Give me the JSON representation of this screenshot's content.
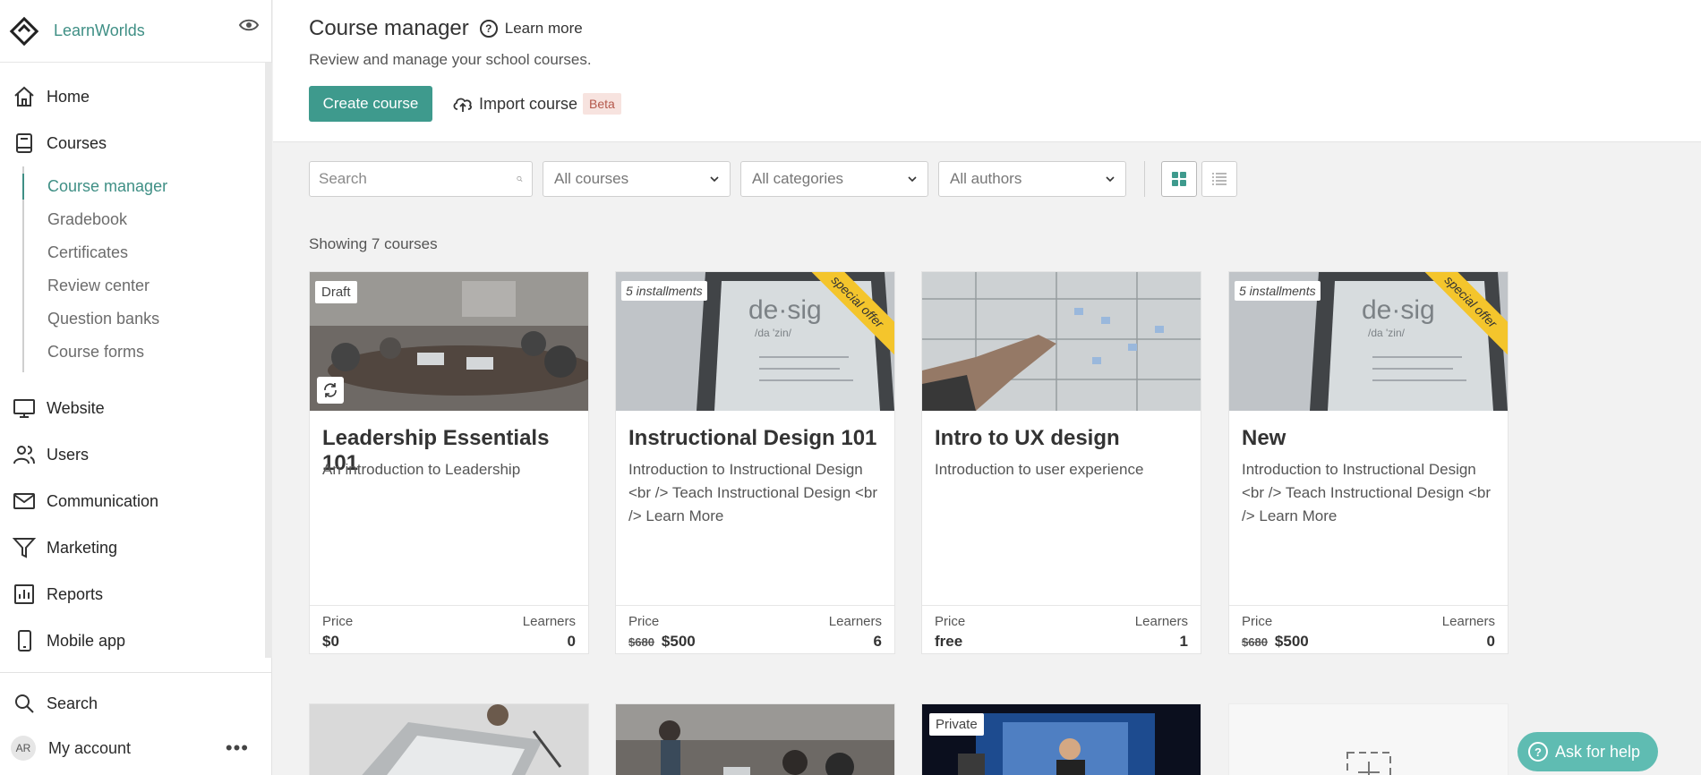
{
  "brand": {
    "name": "LearnWorlds"
  },
  "nav": {
    "home": "Home",
    "courses": "Courses",
    "sub": [
      "Course manager",
      "Gradebook",
      "Certificates",
      "Review center",
      "Question banks",
      "Course forms"
    ],
    "website": "Website",
    "users": "Users",
    "communication": "Communication",
    "marketing": "Marketing",
    "reports": "Reports",
    "mobile_app": "Mobile app",
    "search": "Search",
    "account": "My account",
    "avatar_initials": "AR"
  },
  "header": {
    "title": "Course manager",
    "learn_more": "Learn more",
    "subtitle": "Review and manage your school courses.",
    "create_label": "Create course",
    "import_label": "Import course",
    "beta_label": "Beta"
  },
  "filters": {
    "search_placeholder": "Search",
    "courses_select": "All courses",
    "categories_select": "All categories",
    "authors_select": "All authors"
  },
  "showing": "Showing 7 courses",
  "labels": {
    "price": "Price",
    "learners": "Learners"
  },
  "courses": [
    {
      "tag": "Draft",
      "title": "Leadership Essentials 101",
      "desc": "An introduction to Leadership",
      "price_old": "",
      "price": "$0",
      "learners": "0"
    },
    {
      "tag": "5 installments",
      "ribbon": "special offer",
      "title": "Instructional Design 101",
      "desc": "Introduction to Instructional Design <br /> Teach Instructional Design <br /> Learn More",
      "price_old": "$680",
      "price": "$500",
      "learners": "6"
    },
    {
      "tag": "",
      "title": "Intro to UX design",
      "desc": "Introduction to user experience",
      "price_old": "",
      "price": "free",
      "learners": "1"
    },
    {
      "tag": "5 installments",
      "ribbon": "special offer",
      "title": "New",
      "desc": "Introduction to Instructional Design <br /> Teach Instructional Design <br /> Learn More",
      "price_old": "$680",
      "price": "$500",
      "learners": "0"
    }
  ],
  "row2": {
    "private_tag": "Private"
  },
  "help": {
    "label": "Ask for help"
  },
  "colors": {
    "accent": "#3e9a8d",
    "help": "#5fbcb2",
    "ribbon": "#f4c52c",
    "beta_bg": "#f7e3df"
  }
}
